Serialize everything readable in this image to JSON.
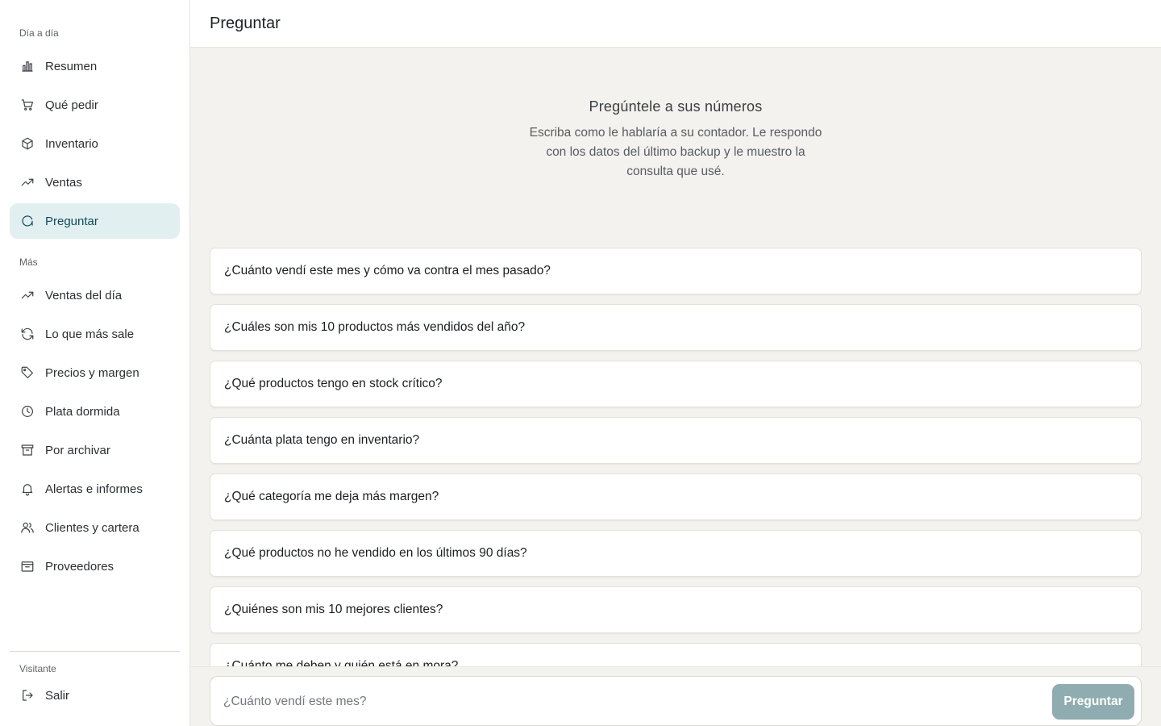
{
  "sidebar": {
    "section_daily": "Día a día",
    "section_more": "Más",
    "section_user": "Visitante",
    "items": [
      {
        "label": "Resumen",
        "icon": "bar-chart-icon"
      },
      {
        "label": "Qué pedir",
        "icon": "cart-icon"
      },
      {
        "label": "Inventario",
        "icon": "box-icon"
      },
      {
        "label": "Ventas",
        "icon": "trend-up-icon"
      },
      {
        "label": "Preguntar",
        "icon": "chat-circle-icon",
        "active": true
      }
    ],
    "more_items": [
      {
        "label": "Ventas del día",
        "icon": "trend-up-icon"
      },
      {
        "label": "Lo que más sale",
        "icon": "refresh-icon"
      },
      {
        "label": "Precios y margen",
        "icon": "tag-icon"
      },
      {
        "label": "Plata dormida",
        "icon": "clock-icon"
      },
      {
        "label": "Por archivar",
        "icon": "archive-icon"
      },
      {
        "label": "Alertas e informes",
        "icon": "bell-icon"
      },
      {
        "label": "Clientes y cartera",
        "icon": "users-icon"
      },
      {
        "label": "Proveedores",
        "icon": "supplier-icon"
      }
    ],
    "logout_label": "Salir"
  },
  "header": {
    "title": "Preguntar"
  },
  "hero": {
    "title": "Pregúntele a sus números",
    "description": "Escriba como le hablaría a su contador. Le respondo con los datos del último backup y le muestro la consulta que usé."
  },
  "questions": [
    "¿Cuánto vendí este mes y cómo va contra el mes pasado?",
    "¿Cuáles son mis 10 productos más vendidos del año?",
    "¿Qué productos tengo en stock crítico?",
    "¿Cuánta plata tengo en inventario?",
    "¿Qué categoría me deja más margen?",
    "¿Qué productos no he vendido en los últimos 90 días?",
    "¿Quiénes son mis 10 mejores clientes?",
    "¿Cuánto me deben y quién está en mora?"
  ],
  "composer": {
    "placeholder": "¿Cuánto vendí este mes?",
    "value": "",
    "button_label": "Preguntar"
  },
  "colors": {
    "accent": "#0f4d58",
    "active_bg": "#e1eff1",
    "button_bg": "#8fadb1",
    "page_bg": "#f3f2ee"
  }
}
